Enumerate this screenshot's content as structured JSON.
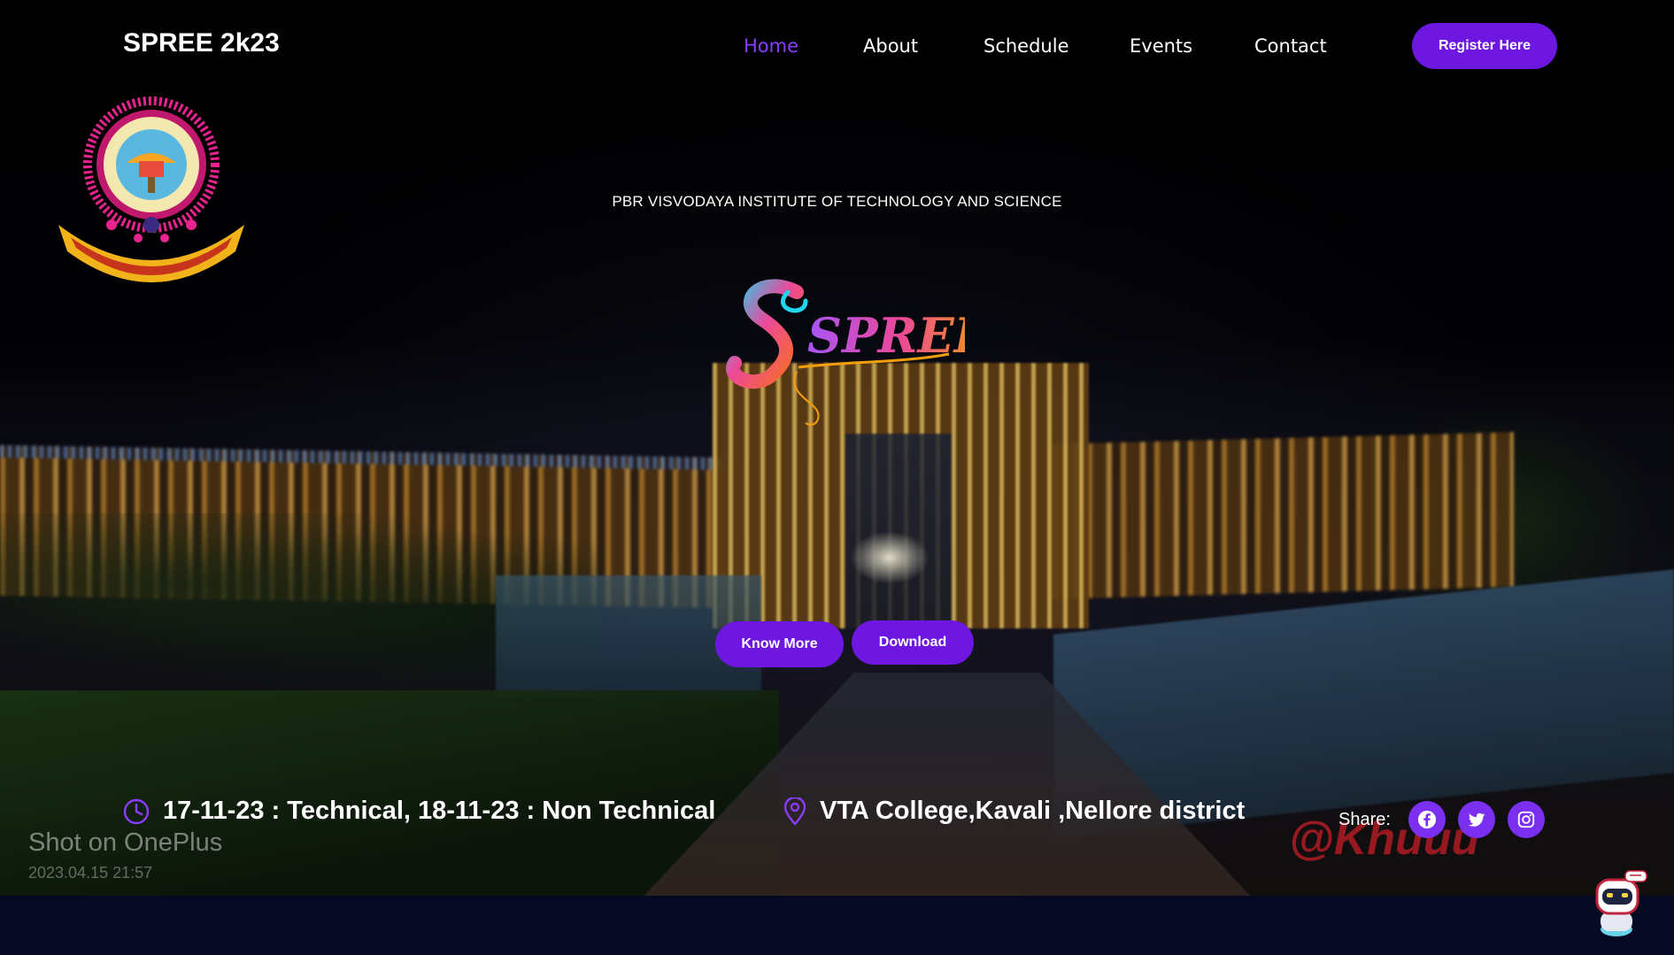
{
  "nav": {
    "brand": "SPREE 2k23",
    "links": [
      "Home",
      "About",
      "Schedule",
      "Events",
      "Contact"
    ],
    "active": "Home",
    "register_label": "Register Here"
  },
  "hero": {
    "institute": "PBR VISVODAYA INSTITUTE OF TECHNOLOGY AND SCIENCE",
    "logo_text": "SPREE",
    "know_more_label": "Know More",
    "download_label": "Download",
    "watermarks": [
      "Shot on OnePlus",
      "2023.04.15 21:57",
      "@Khuuu"
    ]
  },
  "info": {
    "dates": "17-11-23 : Technical, 18-11-23 : Non Technical",
    "venue": "VTA College,Kavali ,Nellore district",
    "share_label": "Share:",
    "socials": [
      "facebook-icon",
      "twitter-icon",
      "instagram-icon"
    ]
  },
  "colors": {
    "accent": "#6d17e0",
    "active_link": "#8b3cff",
    "footer": "#050a22"
  }
}
